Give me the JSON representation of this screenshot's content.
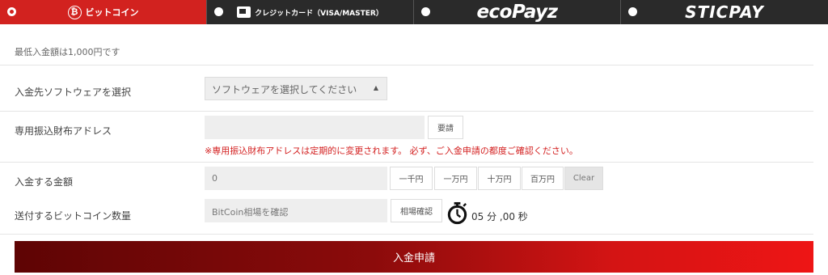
{
  "tabs": [
    {
      "label": "ビットコイン",
      "icon": "bitcoin-icon",
      "active": true
    },
    {
      "label": "クレジットカード（VISA/MASTER）",
      "icon": "credit-card-icon",
      "active": false
    },
    {
      "label": "ecoPayz",
      "active": false
    },
    {
      "label": "STICPAY",
      "active": false
    }
  ],
  "form": {
    "minimum_note": "最低入金額は1,000円です",
    "software": {
      "label": "入金先ソフトウェアを選択",
      "selected": "ソフトウェアを選択してください"
    },
    "wallet": {
      "label": "専用振込財布アドレス",
      "value": "",
      "request_button": "要請",
      "warning": "※専用振込財布アドレスは定期的に変更されます。 必ず、ご入金申請の都度ご確認ください。"
    },
    "amount": {
      "label": "入金する金額",
      "value": "0",
      "buttons": [
        "一千円",
        "一万円",
        "十万円",
        "百万円",
        "Clear"
      ]
    },
    "btc": {
      "label": "送付するビットコイン数量",
      "placeholder": "BitCoin相場を確認",
      "rate_button": "相場確認",
      "timer": "05 分 ,00 秒"
    },
    "submit_label": "入金申請"
  },
  "colors": {
    "active_tab": "#d2221f",
    "tab_bar": "#2a2a2a",
    "warning": "#d31f1f",
    "submit_dark": "#5e0404",
    "submit_bright": "#ee1515"
  }
}
